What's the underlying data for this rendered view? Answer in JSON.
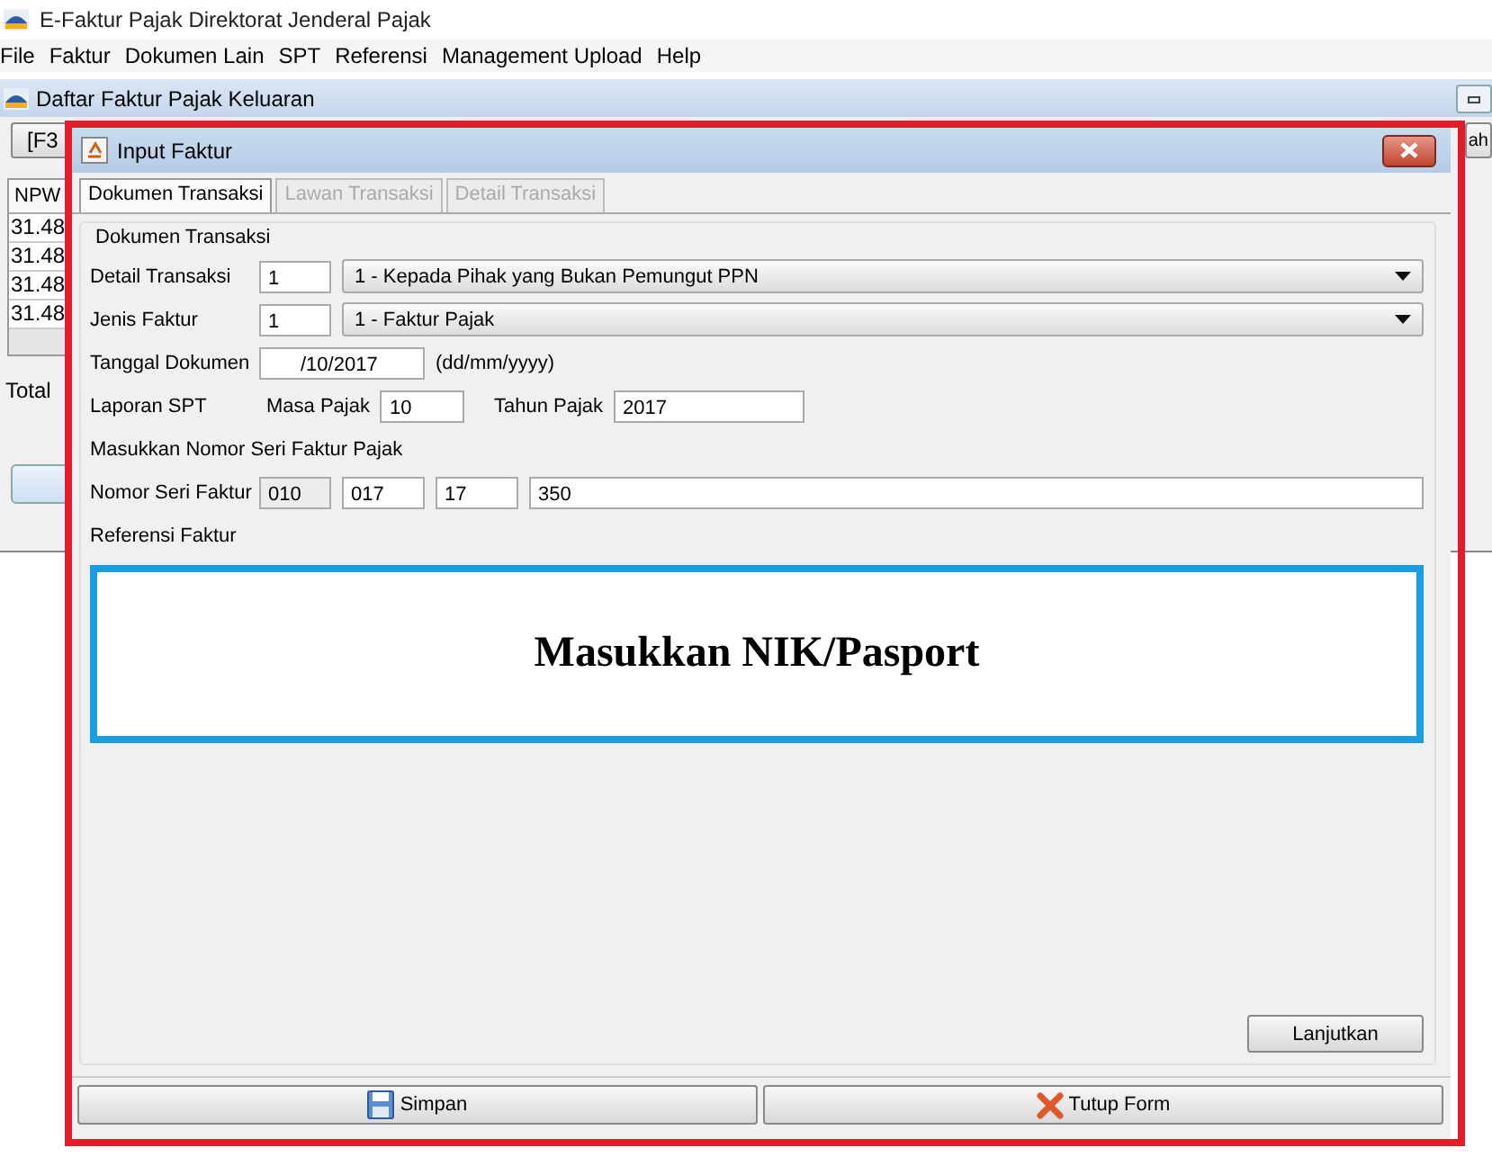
{
  "app": {
    "title": "E-Faktur Pajak Direktorat Jenderal Pajak",
    "menu": [
      "File",
      "Faktur",
      "Dokumen Lain",
      "SPT",
      "Referensi",
      "Management Upload",
      "Help"
    ]
  },
  "background_window": {
    "title": "Daftar Faktur Pajak Keluaran",
    "toolbar_button": "[F3",
    "right_button": "ah",
    "column_1": "NPW",
    "rows": [
      "31.48",
      "31.48",
      "31.48",
      "31.48"
    ],
    "total_label": "Total"
  },
  "dialog": {
    "title": "Input Faktur",
    "tabs": [
      {
        "label": "Dokumen Transaksi",
        "selected": true,
        "disabled": false
      },
      {
        "label": "Lawan Transaksi",
        "selected": false,
        "disabled": true
      },
      {
        "label": "Detail Transaksi",
        "selected": false,
        "disabled": true
      }
    ],
    "group_title": "Dokumen Transaksi",
    "detail_transaksi": {
      "label": "Detail Transaksi",
      "code": "1",
      "choice": "1 - Kepada Pihak yang Bukan Pemungut PPN"
    },
    "jenis_faktur": {
      "label": "Jenis Faktur",
      "code": "1",
      "choice": "1 - Faktur Pajak"
    },
    "tanggal_dokumen": {
      "label": "Tanggal Dokumen",
      "value": "/10/2017",
      "hint": "(dd/mm/yyyy)"
    },
    "laporan_spt": {
      "label": "Laporan SPT",
      "masa_label": "Masa Pajak",
      "masa_value": "10",
      "tahun_label": "Tahun Pajak",
      "tahun_value": "2017"
    },
    "nomor_seri_heading": "Masukkan Nomor Seri Faktur Pajak",
    "nomor_seri": {
      "label": "Nomor Seri Faktur",
      "parts": [
        {
          "value": "010",
          "disabled": true
        },
        {
          "value": "017",
          "disabled": false
        },
        {
          "value": "17",
          "disabled": false
        },
        {
          "value": "350",
          "disabled": false
        }
      ]
    },
    "referensi_label": "Referensi Faktur",
    "callout": "Masukkan NIK/Pasport",
    "next_button": "Lanjutkan",
    "buttons": [
      {
        "label": "Simpan",
        "kind": "save"
      },
      {
        "label": "Tutup Form",
        "kind": "close"
      }
    ]
  }
}
